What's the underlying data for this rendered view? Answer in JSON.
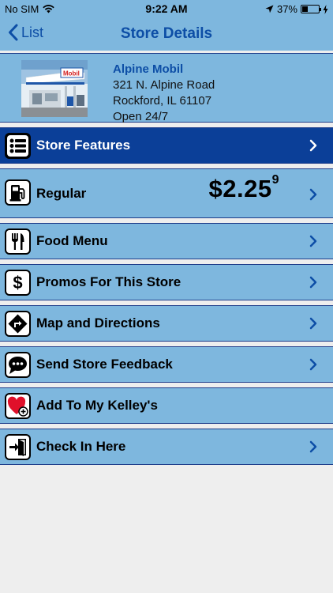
{
  "status_bar": {
    "carrier": "No SIM",
    "time": "9:22 AM",
    "battery_percent": "37%",
    "battery_level": 0.37
  },
  "nav": {
    "back_label": "List",
    "title": "Store Details"
  },
  "store": {
    "name": "Alpine Mobil",
    "address": "321 N. Alpine Road",
    "city": "Rockford, IL 61107",
    "hours": "Open 24/7",
    "sign_text": "Mobil"
  },
  "menu": {
    "store_features": "Store Features",
    "regular": "Regular",
    "price_main": "$2.25",
    "price_fraction": "9",
    "food_menu": "Food Menu",
    "promos": "Promos For This Store",
    "map": "Map and Directions",
    "feedback": "Send Store Feedback",
    "favorites": "Add To My Kelley's",
    "check_in": "Check In Here"
  },
  "colors": {
    "header_bg": "#7eb7de",
    "accent_blue": "#0d4ea6",
    "dark_row": "#0b3f98"
  }
}
